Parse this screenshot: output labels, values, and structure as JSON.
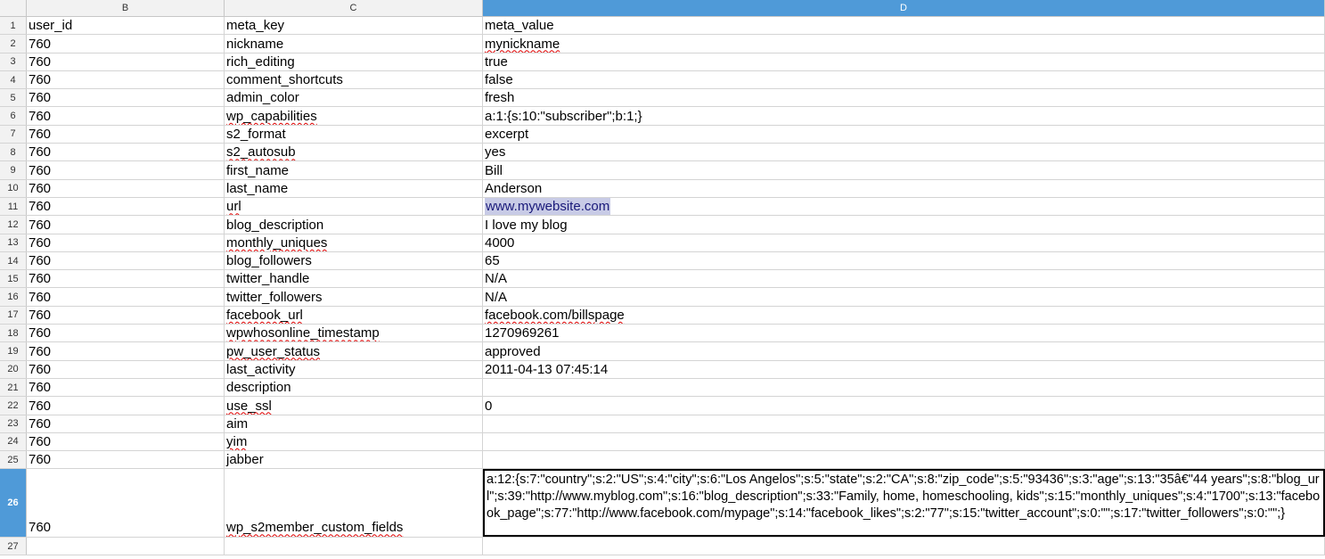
{
  "columns": [
    "B",
    "C",
    "D"
  ],
  "selected_column": "D",
  "rows": [
    {
      "n": "1",
      "b": "user_id",
      "c": "meta_key",
      "d": "meta_value"
    },
    {
      "n": "2",
      "b": "760",
      "c": "nickname",
      "d": "mynickname"
    },
    {
      "n": "3",
      "b": "760",
      "c": "rich_editing",
      "d": "true"
    },
    {
      "n": "4",
      "b": "760",
      "c": "comment_shortcuts",
      "d": "false"
    },
    {
      "n": "5",
      "b": "760",
      "c": "admin_color",
      "d": "fresh"
    },
    {
      "n": "6",
      "b": "760",
      "c": "wp_capabilities",
      "d": "a:1:{s:10:\"subscriber\";b:1;}"
    },
    {
      "n": "7",
      "b": "760",
      "c": "s2_format",
      "d": "excerpt"
    },
    {
      "n": "8",
      "b": "760",
      "c": "s2_autosub",
      "d": "yes"
    },
    {
      "n": "9",
      "b": "760",
      "c": "first_name",
      "d": "Bill"
    },
    {
      "n": "10",
      "b": "760",
      "c": "last_name",
      "d": "Anderson"
    },
    {
      "n": "11",
      "b": "760",
      "c": "url",
      "d": "www.mywebsite.com"
    },
    {
      "n": "12",
      "b": "760",
      "c": "blog_description",
      "d": "I love my blog"
    },
    {
      "n": "13",
      "b": "760",
      "c": "monthly_uniques",
      "d": "4000"
    },
    {
      "n": "14",
      "b": "760",
      "c": "blog_followers",
      "d": "65"
    },
    {
      "n": "15",
      "b": "760",
      "c": "twitter_handle",
      "d": "N/A"
    },
    {
      "n": "16",
      "b": "760",
      "c": "twitter_followers",
      "d": "N/A"
    },
    {
      "n": "17",
      "b": "760",
      "c": "facebook_url",
      "d": "facebook.com/billspage"
    },
    {
      "n": "18",
      "b": "760",
      "c": "wpwhosonline_timestamp",
      "d": "1270969261"
    },
    {
      "n": "19",
      "b": "760",
      "c": "pw_user_status",
      "d": "approved"
    },
    {
      "n": "20",
      "b": "760",
      "c": "last_activity",
      "d": "2011-04-13 07:45:14"
    },
    {
      "n": "21",
      "b": "760",
      "c": "description",
      "d": ""
    },
    {
      "n": "22",
      "b": "760",
      "c": "use_ssl",
      "d": "0"
    },
    {
      "n": "23",
      "b": "760",
      "c": "aim",
      "d": ""
    },
    {
      "n": "24",
      "b": "760",
      "c": "yim",
      "d": ""
    },
    {
      "n": "25",
      "b": "760",
      "c": "jabber",
      "d": ""
    },
    {
      "n": "26",
      "b": "760",
      "c": "wp_s2member_custom_fields",
      "d": "a:12:{s:7:\"country\";s:2:\"US\";s:4:\"city\";s:6:\"Los Angelos\";s:5:\"state\";s:2:\"CA\";s:8:\"zip_code\";s:5:\"93436\";s:3:\"age\";s:13:\"35â€\"44 years\";s:8:\"blog_url\";s:39:\"http://www.myblog.com\";s:16:\"blog_description\";s:33:\"Family, home, homeschooling, kids\";s:15:\"monthly_uniques\";s:4:\"1700\";s:13:\"facebook_page\";s:77:\"http://www.facebook.com/mypage\";s:14:\"facebook_likes\";s:2:\"77\";s:15:\"twitter_account\";s:0:\"\";s:17:\"twitter_followers\";s:0:\"\";}"
    },
    {
      "n": "27",
      "b": "",
      "c": "",
      "d": ""
    }
  ],
  "selected_row": "26",
  "active_cell": "D26",
  "colors": {
    "header_bg": "#f2f2f2",
    "selected_header": "#4f9ad8",
    "grid_line": "#d4d4d4",
    "spell_error": "#e00000"
  }
}
